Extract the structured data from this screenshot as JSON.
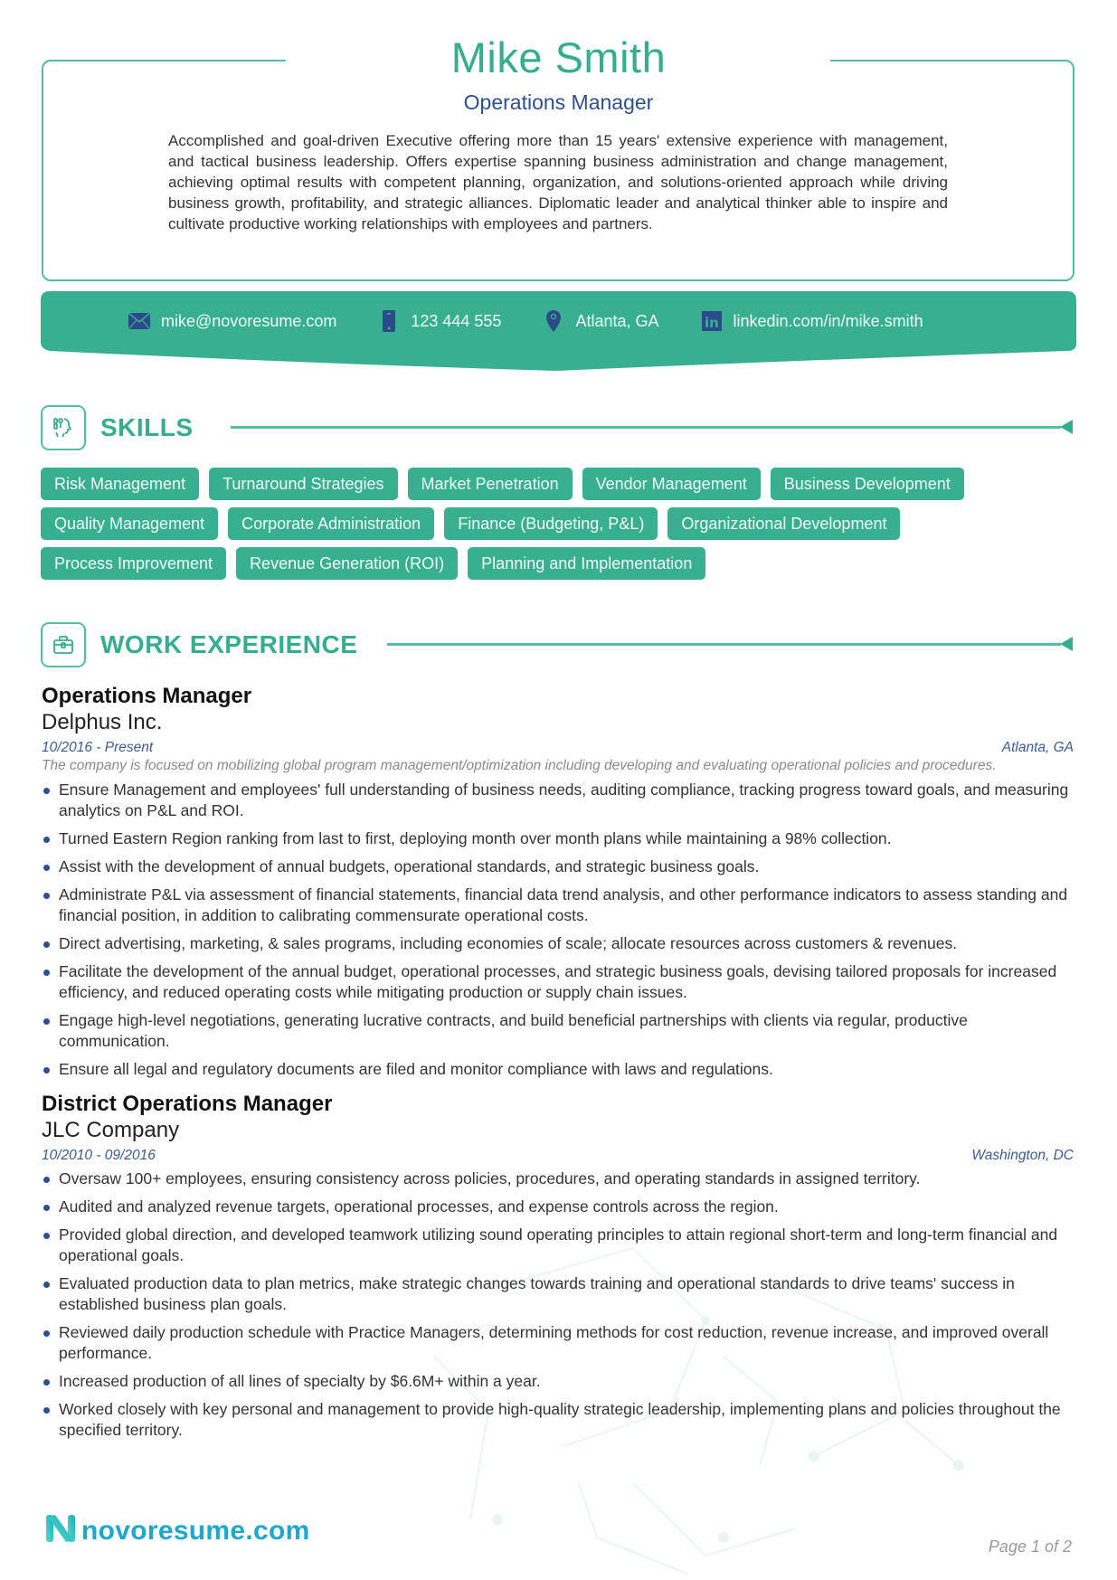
{
  "header": {
    "name": "Mike Smith",
    "title": "Operations Manager",
    "summary": "Accomplished and goal-driven Executive offering more than 15 years' extensive experience with management, and tactical business leadership. Offers expertise spanning business administration and change management, achieving optimal results with competent planning, organization, and solutions-oriented approach while driving business growth, profitability, and strategic alliances. Diplomatic leader and analytical thinker able to inspire and cultivate productive working relationships with employees and partners."
  },
  "contact": {
    "email": {
      "icon": "envelope-icon",
      "value": "mike@novoresume.com"
    },
    "phone": {
      "icon": "phone-icon",
      "value": "123 444 555"
    },
    "location": {
      "icon": "map-pin-icon",
      "value": "Atlanta, GA"
    },
    "linkedin": {
      "icon": "linkedin-icon",
      "value": "linkedin.com/in/mike.smith"
    }
  },
  "sections": {
    "skills": {
      "title": "SKILLS",
      "icon": "skills-head-icon"
    },
    "work": {
      "title": "WORK EXPERIENCE",
      "icon": "briefcase-icon"
    }
  },
  "skills": [
    [
      "Risk Management",
      "Turnaround Strategies",
      "Market Penetration",
      "Vendor Management",
      "Business Development"
    ],
    [
      "Quality Management",
      "Corporate Administration",
      "Finance (Budgeting, P&L)",
      "Organizational Development"
    ],
    [
      "Process Improvement",
      "Revenue Generation (ROI)",
      "Planning and Implementation"
    ]
  ],
  "jobs": [
    {
      "role": "Operations Manager",
      "company": "Delphus Inc.",
      "dates": "10/2016 - Present",
      "location": "Atlanta, GA",
      "description": "The company is focused on mobilizing global program management/optimization including developing and evaluating operational policies and procedures.",
      "bullets": [
        "Ensure Management and employees' full understanding of business needs, auditing compliance, tracking progress toward goals, and measuring analytics on P&L and ROI.",
        "Turned Eastern Region ranking from last to first, deploying month over month plans while maintaining a 98% collection.",
        "Assist with the development of annual budgets, operational standards, and strategic business goals.",
        "Administrate P&L via assessment of financial statements, financial data trend analysis, and other performance indicators to assess standing and financial position, in addition to calibrating commensurate operational costs.",
        "Direct advertising, marketing, & sales programs, including economies of scale; allocate resources across customers & revenues.",
        "Facilitate the development of the annual budget, operational processes, and strategic business goals, devising tailored proposals for increased efficiency, and reduced operating costs while mitigating production or supply chain issues.",
        "Engage high-level negotiations, generating lucrative contracts, and build beneficial partnerships with clients via regular, productive communication.",
        "Ensure all legal and regulatory documents are filed and monitor compliance with laws and regulations."
      ]
    },
    {
      "role": "District Operations Manager",
      "company": "JLC Company",
      "dates": "10/2010 - 09/2016",
      "location": "Washington, DC",
      "description": "",
      "bullets": [
        "Oversaw 100+ employees, ensuring consistency across policies, procedures, and operating standards in assigned territory.",
        "Audited and analyzed revenue targets, operational processes, and expense controls across the region.",
        "Provided global direction, and developed teamwork utilizing sound operating principles to attain regional short-term and long-term financial and operational goals.",
        "Evaluated production data to plan metrics, make strategic changes towards training and operational standards to drive teams' success in established business plan goals.",
        "Reviewed daily production schedule with Practice Managers, determining methods for cost reduction, revenue increase, and improved overall performance.",
        "Increased production of all lines of specialty by $6.6M+ within a year.",
        "Worked closely with key personal and management to provide high-quality strategic leadership, implementing plans and policies throughout the specified territory."
      ]
    }
  ],
  "footer": {
    "brand": "novoresume.com",
    "page": "Page 1 of 2"
  },
  "colors": {
    "accent": "#38b08f",
    "navy": "#2e4f8f",
    "brand": "#1fa8c9"
  }
}
